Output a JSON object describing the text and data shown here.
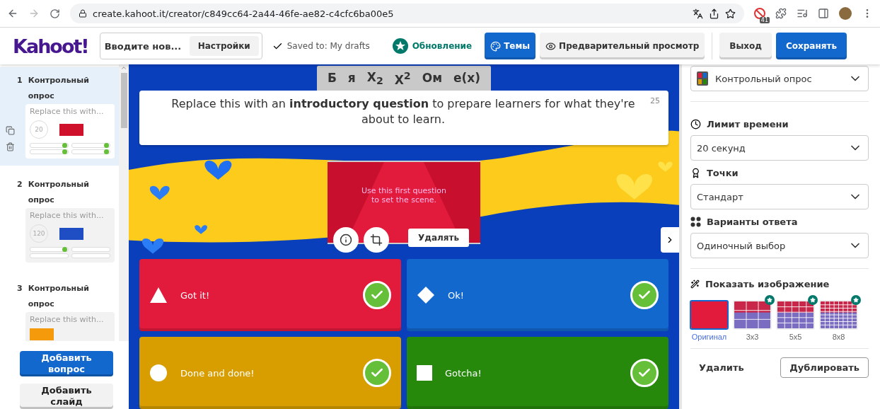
{
  "browser": {
    "url": "create.kahoot.it/creator/c849cc64-2a44-46fe-ae82-c4cfc6ba00e5",
    "extension_badge": "41"
  },
  "header": {
    "logo": "Kahoot!",
    "title_field": {
      "value": "Вводите нов..."
    },
    "settings_button": "Настройки",
    "saved_status": "Saved to: My drafts",
    "upgrade_button": "Обновление",
    "themes_button": "Темы",
    "preview_button": "Предварительный просмотр",
    "exit_button": "Выход",
    "save_button": "Сохранять"
  },
  "sidebar": {
    "items": [
      {
        "number": "1",
        "title": "Контрольный опрос",
        "preview": "Replace this with...",
        "time": "20",
        "color": "#d0112b",
        "selected": true,
        "answers": [
          {
            "correct": true
          },
          {
            "correct": true
          },
          {
            "correct": true
          },
          {
            "correct": true
          }
        ]
      },
      {
        "number": "2",
        "title": "Контрольный опрос",
        "preview": "Replace this with...",
        "time": "120",
        "color": "#1f4ec4",
        "selected": false,
        "answers": [
          {
            "correct": true
          },
          {
            "correct": false
          },
          {
            "correct": false
          },
          {
            "correct": false
          }
        ]
      },
      {
        "number": "3",
        "title": "Контрольный опрос",
        "preview": "Replace this with...",
        "color": "#f59b0b",
        "selected": false
      }
    ],
    "add_question_button": "Добавить вопрос",
    "add_slide_button": "Добавить слайд"
  },
  "editor": {
    "toolbar": [
      "Б",
      "я",
      "X$_{2}$",
      "X$^{2}$",
      "Ом",
      "e(x)"
    ],
    "question": "Replace this with an **introductory question** to prepare learners for what they're about to learn.",
    "char_count": "25",
    "media": {
      "caption": "Use this first question to set the scene.",
      "delete_button": "Удалять"
    },
    "answers": [
      {
        "kind": "triangle",
        "text": "Got it!",
        "color": "#e21b3c",
        "correct": true
      },
      {
        "kind": "diamond",
        "text": "Ok!",
        "color": "#1368ce",
        "correct": true
      },
      {
        "kind": "circle",
        "text": "Done and done!",
        "color": "#d89e00",
        "correct": true
      },
      {
        "kind": "square",
        "text": "Gotcha!",
        "color": "#26890c",
        "correct": true
      }
    ]
  },
  "settings": {
    "question_type": "Контрольный опрос",
    "fields": [
      {
        "kind": "clock",
        "label": "Лимит времени",
        "value": "20 секунд"
      },
      {
        "kind": "medal",
        "label": "Точки",
        "value": "Стандарт"
      },
      {
        "kind": "dots",
        "label": "Варианты ответа",
        "value": "Одиночный выбор"
      }
    ],
    "reveal": {
      "label": "Показать изображение",
      "options": [
        {
          "label": "Оригинал",
          "kind": "original",
          "premium": false,
          "selected": true
        },
        {
          "label": "3x3",
          "kind": "small",
          "premium": true,
          "selected": false
        },
        {
          "label": "5x5",
          "kind": "medium",
          "premium": true,
          "selected": false
        },
        {
          "label": "8x8",
          "kind": "large",
          "premium": true,
          "selected": false
        }
      ]
    },
    "delete_button": "Удалить",
    "duplicate_button": "Дублировать"
  }
}
